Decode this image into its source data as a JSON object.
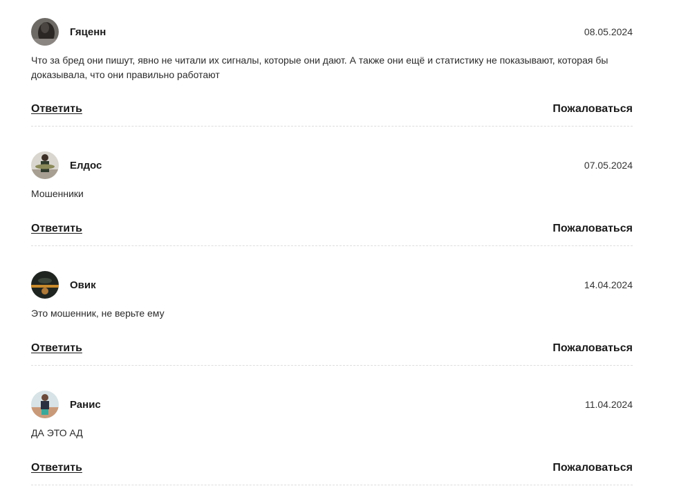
{
  "comments": [
    {
      "author": "Гяценн",
      "date": "08.05.2024",
      "text": "Что за бред они пишут, явно не читали их сигналы, которые они дают. А также они ещё и статистику не показывают, которая бы доказывала, что они правильно работают",
      "reply_label": "Ответить",
      "report_label": "Пожаловаться"
    },
    {
      "author": "Елдос",
      "date": "07.05.2024",
      "text": "Мошенники",
      "reply_label": "Ответить",
      "report_label": "Пожаловаться"
    },
    {
      "author": "Овик",
      "date": "14.04.2024",
      "text": "Это мошенник, не верьте ему",
      "reply_label": "Ответить",
      "report_label": "Пожаловаться"
    },
    {
      "author": "Ранис",
      "date": "11.04.2024",
      "text": "ДА ЭТО АД",
      "reply_label": "Ответить",
      "report_label": "Пожаловаться"
    }
  ]
}
